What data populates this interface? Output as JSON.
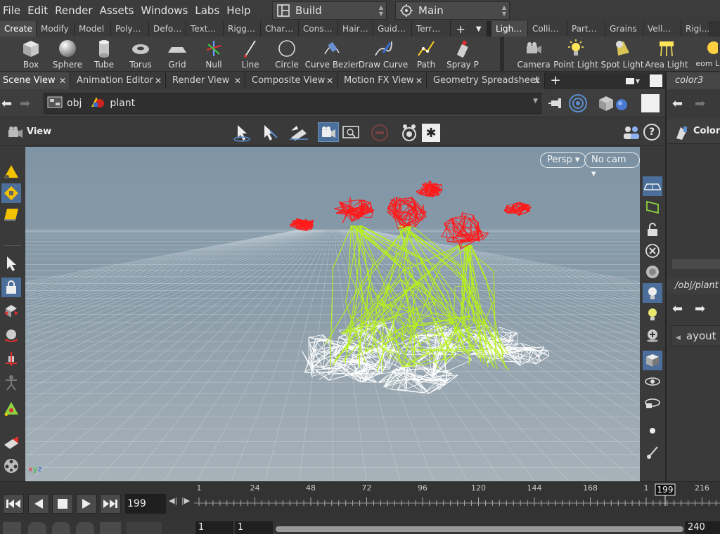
{
  "menu": [
    "File",
    "Edit",
    "Render",
    "Assets",
    "Windows",
    "Labs",
    "Help"
  ],
  "desktop": {
    "layout": "Build",
    "context": "Main"
  },
  "shelf_tabs": [
    "Create",
    "Modify",
    "Model",
    "Poly…",
    "Defo…",
    "Text…",
    "Rigg…",
    "Char…",
    "Cons…",
    "Hair…",
    "Guid…",
    "Terr…"
  ],
  "shelf_tabs_right": [
    "Ligh…",
    "Colli…",
    "Part…",
    "Grains",
    "Vell…",
    "Rigi…"
  ],
  "shelf_tools": [
    "Box",
    "Sphere",
    "Tube",
    "Torus",
    "Grid",
    "Null",
    "Line",
    "Circle",
    "Curve Bezier",
    "Draw Curve",
    "Path",
    "Spray P"
  ],
  "light_tools": [
    "Camera",
    "Point Light",
    "Spot Light",
    "Area Light",
    "Geom Lig"
  ],
  "pane_tabs": [
    "Scene View",
    "Animation Editor",
    "Render View",
    "Composite View",
    "Motion FX View",
    "Geometry Spreadsheet"
  ],
  "path": {
    "root": "obj",
    "node": "plant"
  },
  "viewer": {
    "label": "View",
    "projection": "Persp",
    "camera": "No cam"
  },
  "right_panel": {
    "tab": "color3",
    "node_label": "Color",
    "path": "/obj/plant",
    "layout_label": "ayout"
  },
  "timeline": {
    "current_frame": "199",
    "ticks": [
      "1",
      "24",
      "48",
      "72",
      "96",
      "120",
      "144",
      "168",
      "1",
      "216"
    ],
    "marker": "199",
    "start_field": "1",
    "start_field2": "1",
    "end_field": "240"
  },
  "axis": {
    "x": "x",
    "y": "y",
    "z": "z"
  },
  "colors": {
    "accent": "#5b8fcf",
    "flowers": "#ff1a1a",
    "stems": "#b6f21a",
    "leaves": "#ffffff"
  }
}
